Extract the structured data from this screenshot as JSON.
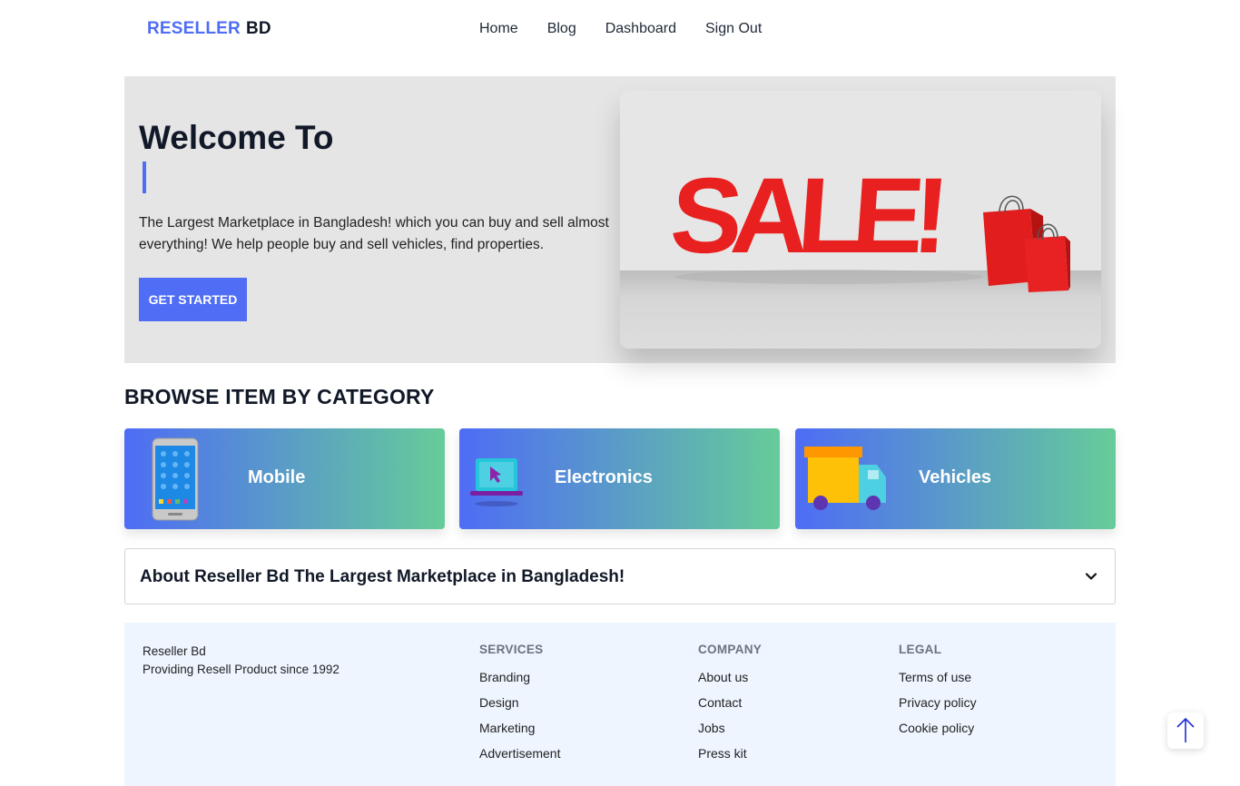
{
  "nav": {
    "brand_part1": "RESELLER",
    "brand_part2": "BD",
    "links": [
      "Home",
      "Blog",
      "Dashboard",
      "Sign Out"
    ]
  },
  "hero": {
    "title": "Welcome To",
    "description": "The Largest Marketplace in Bangladesh! which you can buy and sell almost everything! We help people buy and sell vehicles, find properties.",
    "cta_label": "GET STARTED",
    "sale_text": "SALE!"
  },
  "categories": {
    "heading": "BROWSE ITEM BY CATEGORY",
    "items": [
      {
        "label": "Mobile",
        "icon": "mobile-phone-icon"
      },
      {
        "label": "Electronics",
        "icon": "laptop-icon"
      },
      {
        "label": "Vehicles",
        "icon": "truck-icon"
      }
    ]
  },
  "accordion": {
    "title": "About Reseller Bd The Largest Marketplace in Bangladesh!"
  },
  "footer": {
    "brand_name": "Reseller Bd",
    "brand_tagline": "Providing Resell Product since 1992",
    "columns": [
      {
        "heading": "SERVICES",
        "links": [
          "Branding",
          "Design",
          "Marketing",
          "Advertisement"
        ]
      },
      {
        "heading": "COMPANY",
        "links": [
          "About us",
          "Contact",
          "Jobs",
          "Press kit"
        ]
      },
      {
        "heading": "LEGAL",
        "links": [
          "Terms of use",
          "Privacy policy",
          "Cookie policy"
        ]
      }
    ]
  },
  "colors": {
    "accent": "#4f6df5",
    "gradient_end": "#66cc99",
    "sale_red": "#e8201f",
    "footer_bg": "#eef5ff"
  }
}
